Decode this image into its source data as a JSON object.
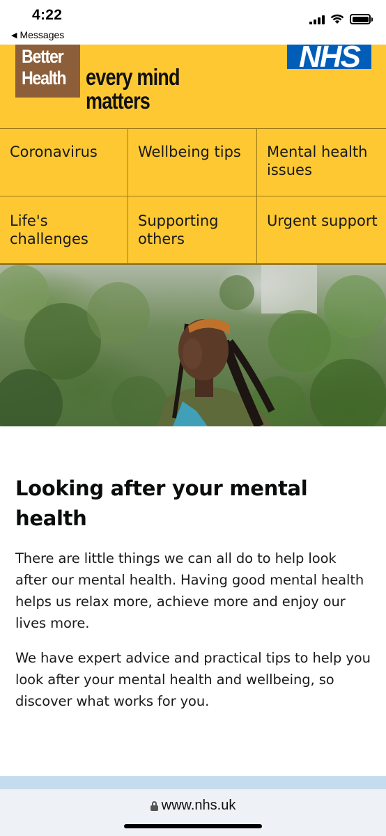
{
  "status_bar": {
    "time": "4:22",
    "back_label": "Messages",
    "back_icon": "back-triangle-icon",
    "icons": [
      "cellular-signal-icon",
      "wifi-icon",
      "battery-icon"
    ]
  },
  "header": {
    "logo_line1": "Better",
    "logo_line2": "Health",
    "tagline_line1": "every mind",
    "tagline_line2": "matters",
    "nhs_logo": "NHS",
    "colors": {
      "background": "#fdc832",
      "logo_brown": "#8d5e3a",
      "nhs_blue": "#005eb8"
    }
  },
  "nav": {
    "items": [
      {
        "label": "Coronavirus"
      },
      {
        "label": "Wellbeing tips"
      },
      {
        "label": "Mental health issues"
      },
      {
        "label": "Life's challenges"
      },
      {
        "label": "Supporting others"
      },
      {
        "label": "Urgent support"
      }
    ]
  },
  "main": {
    "headline": "Looking after your mental health",
    "paragraph1": "There are little things we can all do to help look after our mental health. Having good mental health helps us relax more, achieve more and enjoy our lives more.",
    "paragraph2": "We have expert advice and practical tips to help you look after your mental health and wellbeing, so discover what works for you."
  },
  "browser": {
    "url": "www.nhs.uk",
    "lock_icon": "lock-icon"
  }
}
